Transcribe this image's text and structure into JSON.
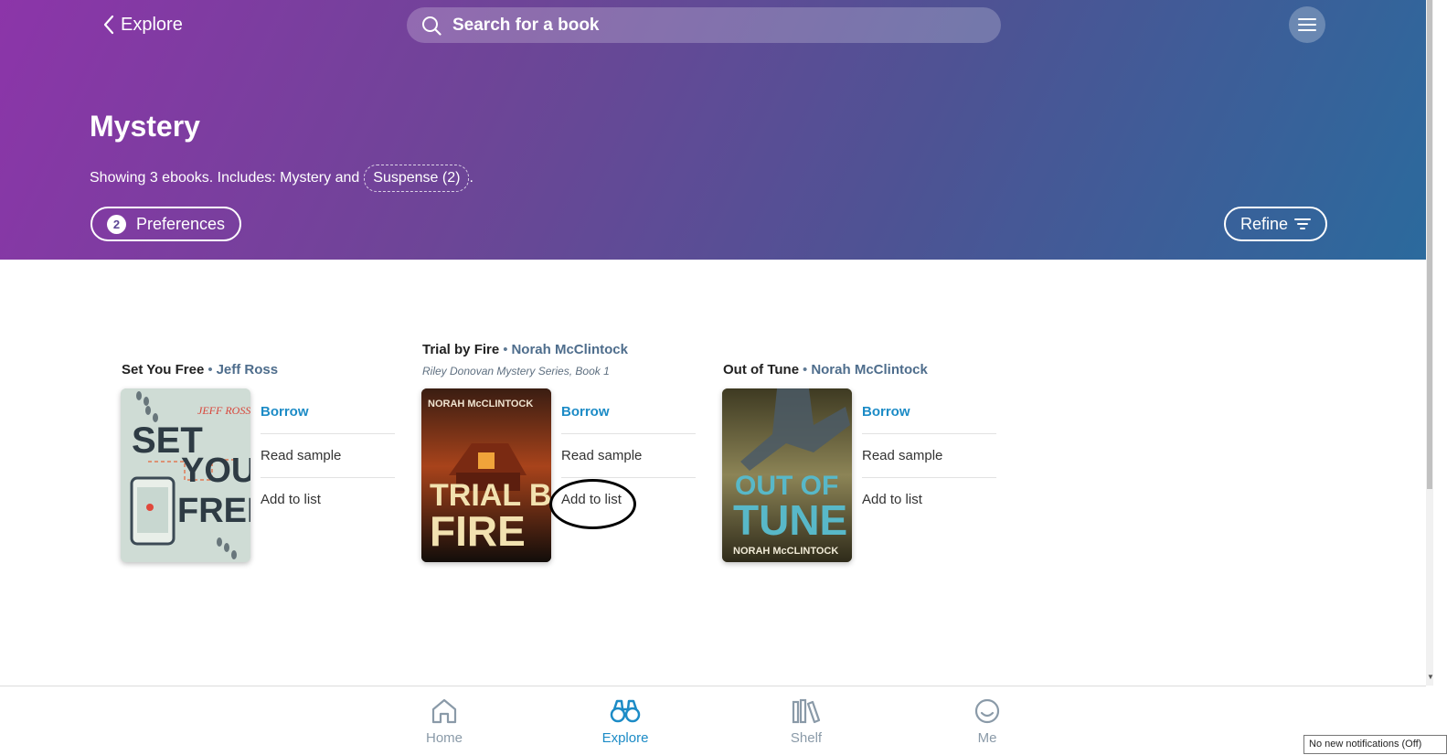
{
  "header": {
    "back_label": "Explore",
    "search_placeholder": "Search for a book",
    "colors": {
      "gradient_start": "#8c35a9",
      "gradient_end": "#2b6a9d"
    }
  },
  "category": {
    "title": "Mystery",
    "showing_text": "Showing 3 ebooks. Includes: Mystery and",
    "chip_label": "Suspense (2)",
    "after_chip": ".",
    "preferences_count": "2",
    "preferences_label": "Preferences",
    "refine_label": "Refine"
  },
  "books": [
    {
      "title": "Set You Free",
      "author": "Jeff Ross",
      "series": "",
      "cover_text": {
        "line1": "SET",
        "line2": "YOU",
        "line3": "FREE",
        "author": "JEFF ROSS"
      },
      "actions": {
        "borrow": "Borrow",
        "sample": "Read sample",
        "list": "Add to list"
      }
    },
    {
      "title": "Trial by Fire",
      "author": "Norah McClintock",
      "series": "Riley Donovan Mystery Series, Book 1",
      "cover_text": {
        "author": "NORAH McCLINTOCK",
        "line1": "TRIAL BY",
        "line2": "FIRE"
      },
      "actions": {
        "borrow": "Borrow",
        "sample": "Read sample",
        "list": "Add to list"
      }
    },
    {
      "title": "Out of Tune",
      "author": "Norah McClintock",
      "series": "",
      "cover_text": {
        "line1": "OUT OF",
        "line2": "TUNE",
        "author": "NORAH McCLINTOCK"
      },
      "actions": {
        "borrow": "Borrow",
        "sample": "Read sample",
        "list": "Add to list"
      }
    }
  ],
  "bottom_nav": [
    {
      "label": "Home",
      "icon": "home-icon",
      "active": false
    },
    {
      "label": "Explore",
      "icon": "binoculars-icon",
      "active": true
    },
    {
      "label": "Shelf",
      "icon": "shelf-icon",
      "active": false
    },
    {
      "label": "Me",
      "icon": "smiley-icon",
      "active": false
    }
  ],
  "notification": "No new notifications (Off)"
}
